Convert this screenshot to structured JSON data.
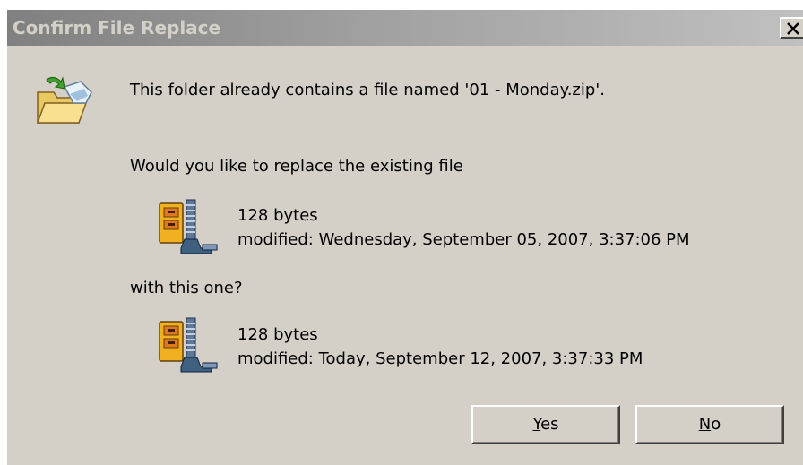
{
  "dialog": {
    "title": "Confirm File Replace",
    "message": "This folder already contains a file named '01 - Monday.zip'.",
    "question": "Would you like to replace the existing file",
    "existing_file": {
      "size": "128 bytes",
      "modified": "modified: Wednesday, September 05, 2007, 3:37:06 PM",
      "icon": "zip-archive-icon"
    },
    "with_label": "with this one?",
    "new_file": {
      "size": "128 bytes",
      "modified": "modified: Today, September 12, 2007, 3:37:33 PM",
      "icon": "zip-archive-icon"
    },
    "buttons": {
      "yes": {
        "mnemonic": "Y",
        "rest": "es"
      },
      "no": {
        "mnemonic": "N",
        "rest": "o"
      }
    },
    "header_icon": "folder-replace-icon",
    "close_icon": "close-icon"
  }
}
